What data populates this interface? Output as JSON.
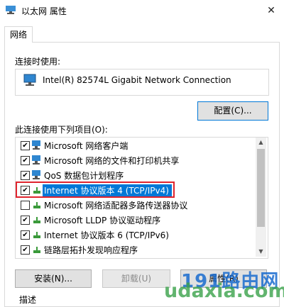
{
  "window": {
    "title": "以太网 属性",
    "close_glyph": "✕"
  },
  "tabs": [
    {
      "label": "网络"
    }
  ],
  "connect": {
    "label": "连接时使用:",
    "adapter": "Intel(R) 82574L Gigabit Network Connection"
  },
  "config_button": "配置(C)...",
  "items_label": "此连接使用下列项目(O):",
  "items": [
    {
      "label": "Microsoft 网络客户端",
      "checked": true,
      "icon": "network-client-icon"
    },
    {
      "label": "Microsoft 网络的文件和打印机共享",
      "checked": true,
      "icon": "network-share-icon"
    },
    {
      "label": "QoS 数据包计划程序",
      "checked": true,
      "icon": "network-service-icon"
    },
    {
      "label": "Internet 协议版本 4 (TCP/IPv4)",
      "checked": true,
      "selected": true,
      "icon": "protocol-icon"
    },
    {
      "label": "Microsoft 网络适配器多路传送器协议",
      "checked": false,
      "icon": "protocol-icon"
    },
    {
      "label": "Microsoft LLDP 协议驱动程序",
      "checked": true,
      "icon": "protocol-icon"
    },
    {
      "label": "Internet 协议版本 6 (TCP/IPv6)",
      "checked": true,
      "icon": "protocol-icon"
    },
    {
      "label": "链路层拓扑发现响应程序",
      "checked": true,
      "icon": "protocol-icon"
    }
  ],
  "buttons": {
    "install": "安装(N)...",
    "uninstall": "卸载(U)",
    "properties": "属性(R)"
  },
  "description_label": "描述",
  "watermark": {
    "cn": "191路由网",
    "en": "udaxia.com"
  },
  "colors": {
    "accent": "#0078d7",
    "highlight_border": "#e0242e"
  }
}
